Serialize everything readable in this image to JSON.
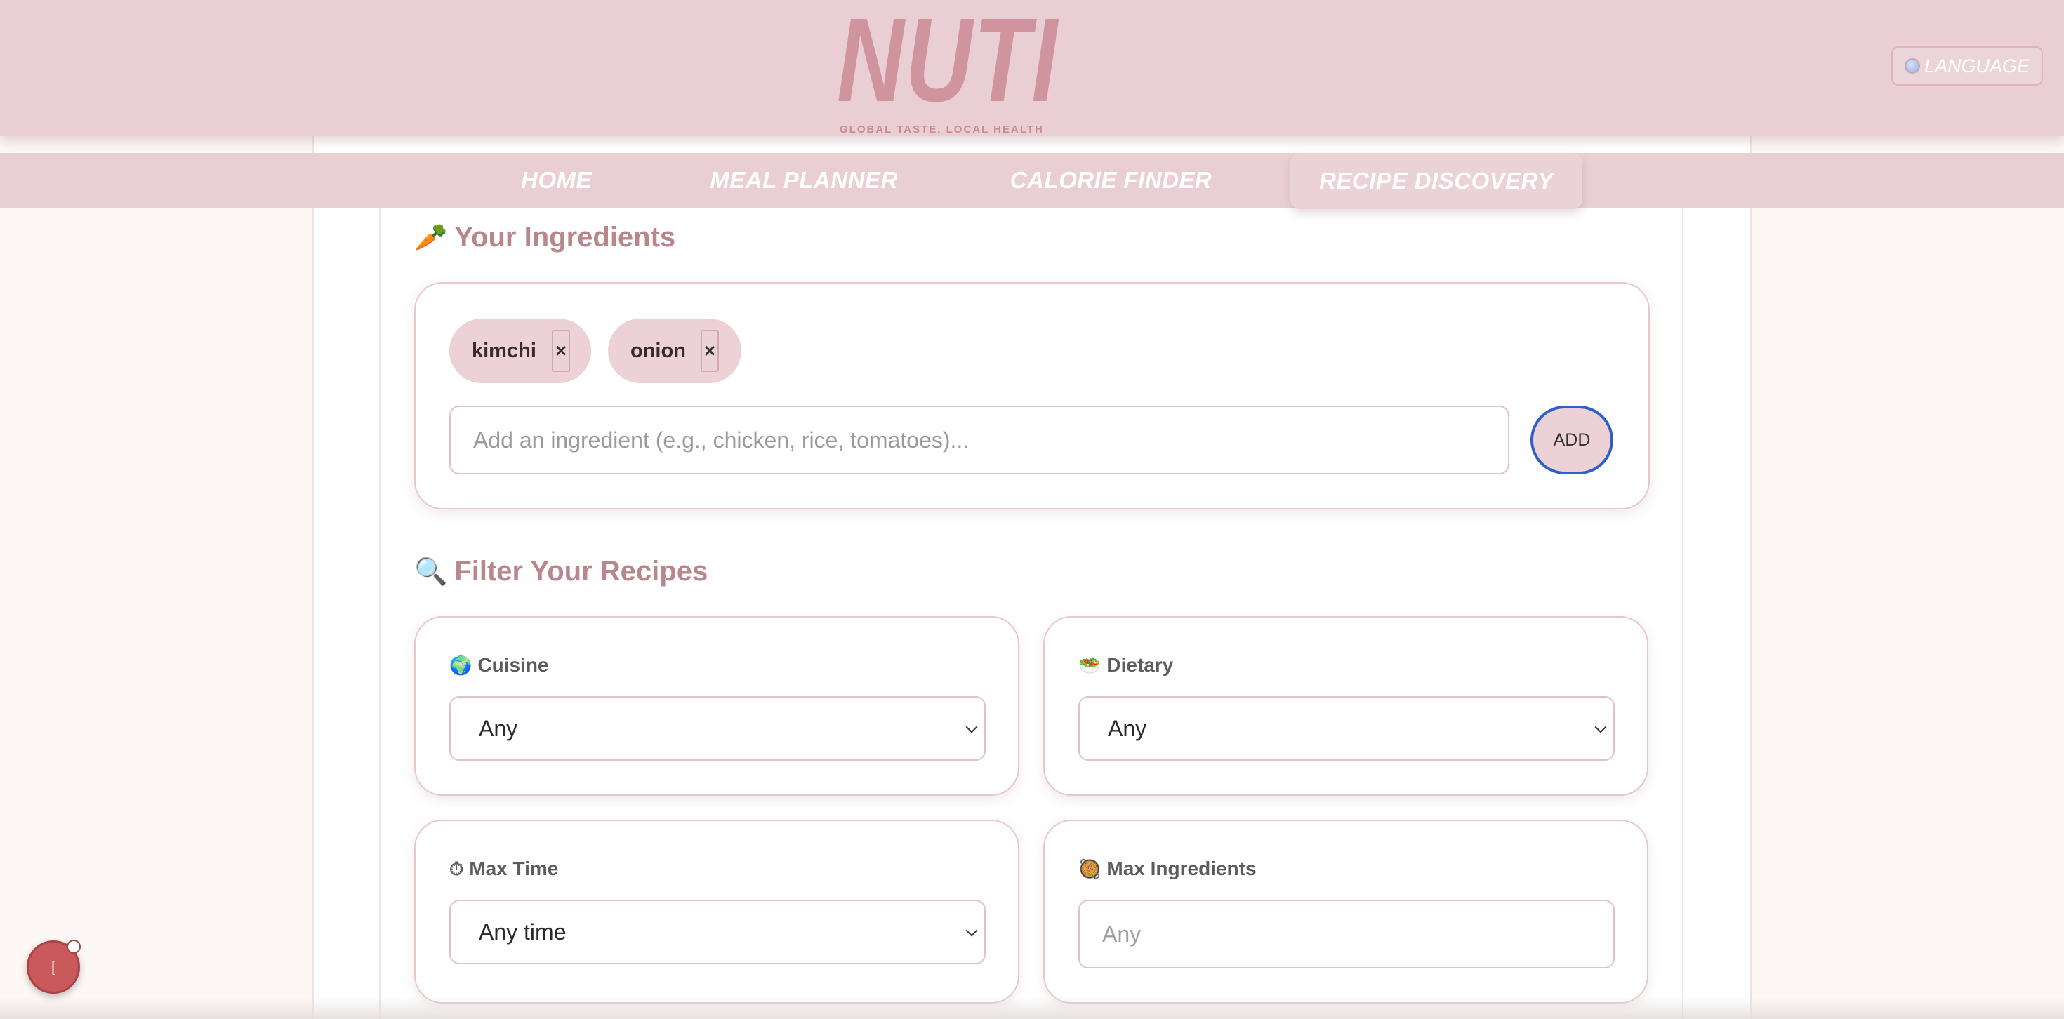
{
  "header": {
    "logo_text": "NUTI",
    "tagline": "GLOBAL TASTE, LOCAL HEALTH",
    "language_label": "LANGUAGE",
    "language_icon": "globe-icon"
  },
  "nav": {
    "items": [
      {
        "label": "HOME",
        "active": false
      },
      {
        "label": "MEAL PLANNER",
        "active": false
      },
      {
        "label": "CALORIE FINDER",
        "active": false
      },
      {
        "label": "RECIPE DISCOVERY",
        "active": true
      }
    ]
  },
  "ingredients": {
    "title": "Your Ingredients",
    "title_icon": "🥕",
    "chips": [
      {
        "label": "kimchi",
        "remove": "×"
      },
      {
        "label": "onion",
        "remove": "×"
      }
    ],
    "input_placeholder": "Add an ingredient (e.g., chicken, rice, tomatoes)...",
    "add_label": "ADD"
  },
  "filters": {
    "title": "Filter Your Recipes",
    "title_icon": "🔍",
    "cuisine": {
      "label": "Cuisine",
      "icon": "🌍",
      "value": "Any"
    },
    "dietary": {
      "label": "Dietary",
      "icon": "🥗",
      "value": "Any"
    },
    "max_time": {
      "label": "Max Time",
      "icon": "⏱",
      "value": "Any time"
    },
    "max_ingredients": {
      "label": "Max Ingredients",
      "icon": "🥘",
      "placeholder": "Any"
    }
  },
  "fab": {
    "label": "["
  },
  "colors": {
    "header_bg": "#e9cfd3",
    "accent": "#b8868c",
    "chip_bg": "#ecd2d6",
    "focus_ring": "#2f5fc8",
    "fab": "#c9595b"
  }
}
